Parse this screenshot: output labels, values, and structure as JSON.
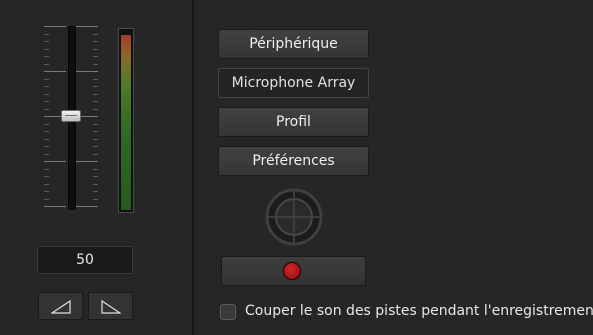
{
  "fader": {
    "value_text": "50",
    "level_percent": 50
  },
  "vu_meter": {
    "level_fraction": 0.98
  },
  "buttons": {
    "device_label": "Périphérique",
    "device_value": "Microphone Array",
    "profile_label": "Profil",
    "preferences_label": "Préférences"
  },
  "icons": {
    "fade_in": "fade-in-ramp-icon",
    "fade_out": "fade-out-ramp-icon",
    "crosshair": "target-crosshair-icon",
    "record": "record-dot-icon"
  },
  "checkbox": {
    "label": "Couper le son des pistes pendant l'enregistrement",
    "checked": false
  },
  "colors": {
    "record": "#c81e24",
    "panel": "#262626",
    "meter_green": "#2f6a24",
    "meter_red": "#a33a2a"
  }
}
